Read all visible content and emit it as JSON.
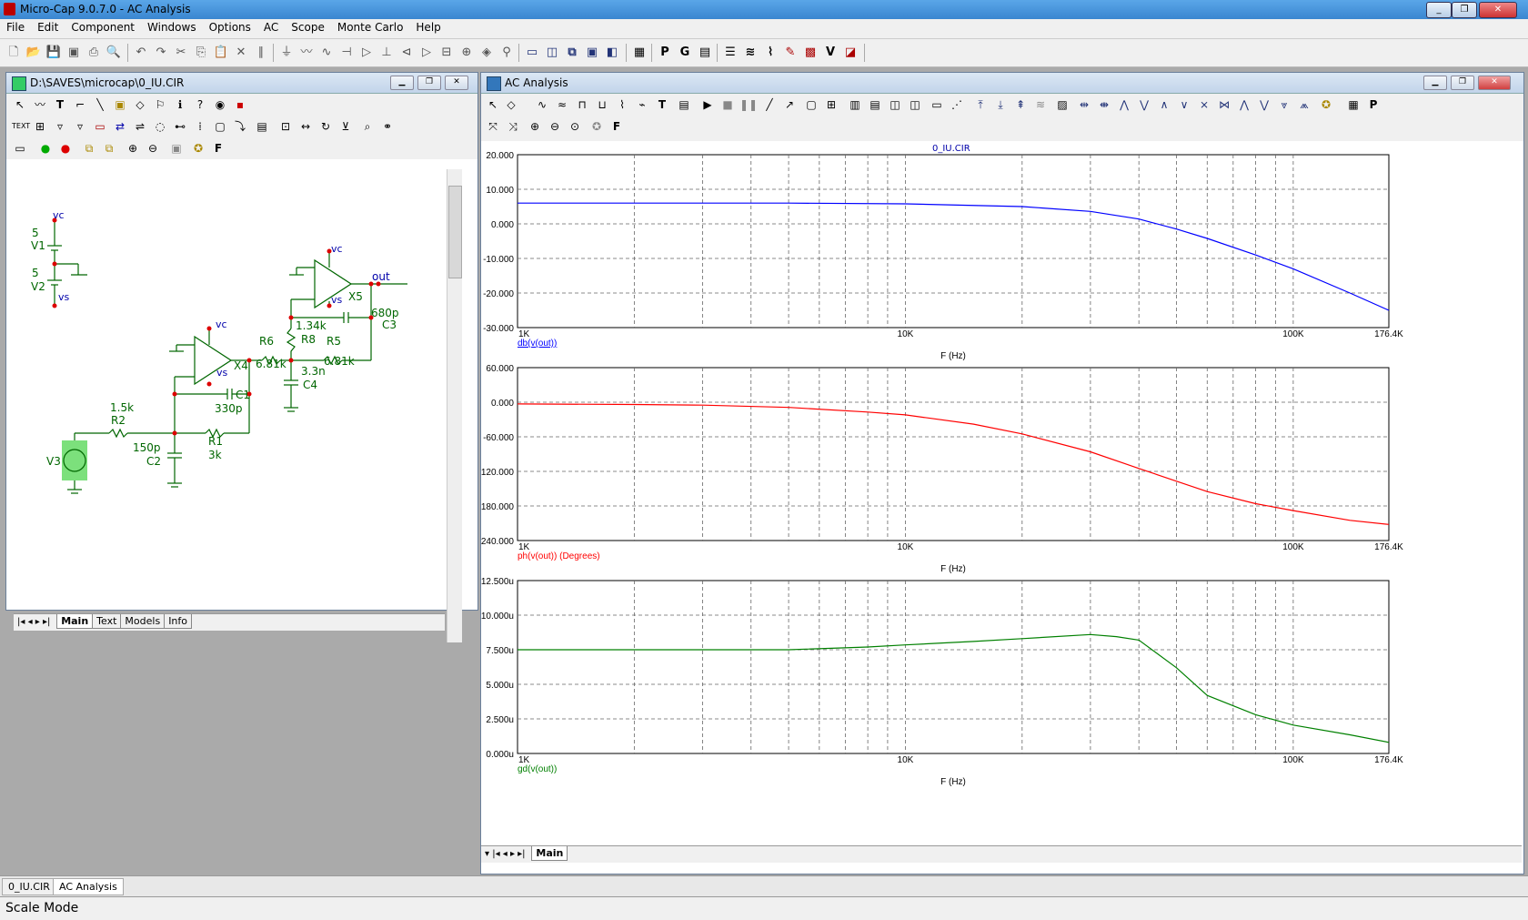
{
  "app": {
    "title": "Micro-Cap 9.0.7.0 - AC Analysis"
  },
  "menu": [
    "File",
    "Edit",
    "Component",
    "Windows",
    "Options",
    "AC",
    "Scope",
    "Monte Carlo",
    "Help"
  ],
  "schematic_window": {
    "title": "D:\\SAVES\\microcap\\0_IU.CIR",
    "tabs": [
      "Main",
      "Text",
      "Models",
      "Info"
    ],
    "labels": {
      "vc1": "vc",
      "v1_val": "5",
      "v1": "V1",
      "v2_val": "5",
      "v2": "V2",
      "vs1": "vs",
      "vc2": "vc",
      "out": "out",
      "x5": "X5",
      "vs2": "vs",
      "c3_val": "680p",
      "c3": "C3",
      "r8_val": "1.34k",
      "r8": "R8",
      "r5": "R5",
      "r5_val": "6.81k",
      "vc3": "vc",
      "x4": "X4",
      "vs3": "vs",
      "r6": "R6",
      "r6_val": "6.81k",
      "c4_val": "3.3n",
      "c4": "C4",
      "c1": "C1",
      "c1_val": "330p",
      "r2_val": "1.5k",
      "r2": "R2",
      "c2_val": "150p",
      "c2": "C2",
      "r1": "R1",
      "r1_val": "3k",
      "v3": "V3"
    }
  },
  "analysis_window": {
    "title": "AC Analysis",
    "file_title": "0_IU.CIR",
    "tabs": [
      "Main"
    ],
    "x_axis": {
      "label": "F (Hz)",
      "ticks": [
        "1K",
        "10K",
        "100K",
        "176.4K"
      ]
    }
  },
  "chart_data": [
    {
      "type": "line",
      "series": [
        {
          "name": "db(v(out))",
          "color": "#0000ff",
          "x": [
            1000,
            5000,
            10000,
            20000,
            30000,
            40000,
            50000,
            60000,
            80000,
            100000,
            140000,
            176400
          ],
          "values": [
            6,
            6,
            5.8,
            5.0,
            3.6,
            1.4,
            -1.5,
            -4.2,
            -9,
            -13,
            -20,
            -25
          ]
        }
      ],
      "xscale": "log",
      "xlim": [
        1000,
        176400
      ],
      "ylim": [
        -30,
        20
      ],
      "yticks": [
        "20.000",
        "10.000",
        "0.000",
        "-10.000",
        "-20.000",
        "-30.000"
      ],
      "xlabel": "F (Hz)"
    },
    {
      "type": "line",
      "series": [
        {
          "name": "ph(v(out)) (Degrees)",
          "color": "#ff0000",
          "x": [
            1000,
            2000,
            3000,
            5000,
            8000,
            10000,
            15000,
            20000,
            30000,
            40000,
            50000,
            60000,
            80000,
            100000,
            140000,
            176400
          ],
          "values": [
            -3,
            -4,
            -5,
            -9,
            -17,
            -22,
            -38,
            -55,
            -86,
            -115,
            -137,
            -155,
            -176,
            -188,
            -205,
            -212
          ]
        }
      ],
      "xscale": "log",
      "xlim": [
        1000,
        176400
      ],
      "ylim": [
        -240,
        60
      ],
      "yticks": [
        "60.000",
        "0.000",
        "-60.000",
        "-120.000",
        "-180.000",
        "-240.000"
      ],
      "xlabel": "F (Hz)"
    },
    {
      "type": "line",
      "series": [
        {
          "name": "gd(v(out))",
          "color": "#008000",
          "x": [
            1000,
            3000,
            5000,
            8000,
            10000,
            15000,
            20000,
            30000,
            35000,
            40000,
            50000,
            60000,
            80000,
            100000,
            140000,
            176400
          ],
          "values": [
            7.5,
            7.5,
            7.5,
            7.7,
            7.85,
            8.1,
            8.3,
            8.6,
            8.45,
            8.2,
            6.2,
            4.2,
            2.8,
            2.05,
            1.35,
            0.8
          ]
        }
      ],
      "xscale": "log",
      "xlim": [
        1000,
        176400
      ],
      "ylim": [
        0,
        12.5
      ],
      "yticks": [
        "12.500u",
        "10.000u",
        "7.500u",
        "5.000u",
        "2.500u",
        "0.000u"
      ],
      "xlabel": "F (Hz)"
    }
  ],
  "doc_tabs": [
    "0_IU.CIR",
    "AC Analysis"
  ],
  "status": "Scale Mode"
}
